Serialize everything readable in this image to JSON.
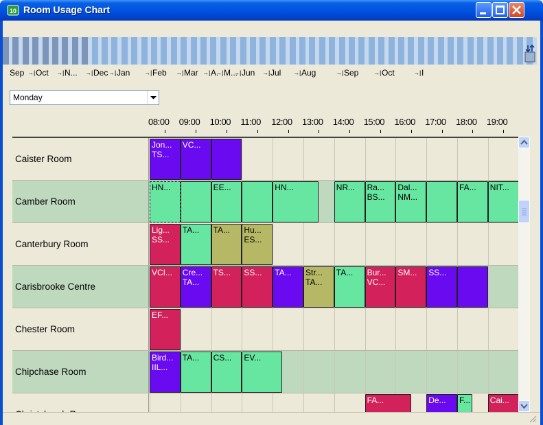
{
  "window": {
    "title": "Room Usage Chart"
  },
  "colors": {
    "green": "#66e6a0",
    "purple": "#6a0af0",
    "crimson": "#d3215c",
    "olive": "#b6b865",
    "rowGreen": "#bfd9bf",
    "rowBeige": "#ece9d8"
  },
  "months": [
    "Sep",
    "Oct",
    "N...",
    "Dec",
    "Jan",
    "Feb",
    "Mar",
    "A.",
    "M...",
    "Jun",
    "Jul",
    "Aug",
    "Sep",
    "Oct",
    "I"
  ],
  "day_select": {
    "value": "Monday"
  },
  "times": [
    "08:00",
    "09:00",
    "10:00",
    "11:00",
    "12:00",
    "13:00",
    "14:00",
    "15:00",
    "16:00",
    "17:00",
    "18:00",
    "19:00"
  ],
  "rooms": [
    {
      "name": "Caister Room",
      "bg": "#ece9d8",
      "bookings": [
        {
          "l1": "Jon...",
          "l2": "TS...",
          "color": "#6a0af0",
          "start": 0,
          "span": 1
        },
        {
          "l1": "VC...",
          "l2": "",
          "color": "#6a0af0",
          "start": 1,
          "span": 1
        },
        {
          "l1": "",
          "l2": "",
          "color": "#6a0af0",
          "start": 2,
          "span": 1
        }
      ]
    },
    {
      "name": "Camber Room",
      "bg": "#bfd9bf",
      "bookings": [
        {
          "l1": "HN...",
          "l2": "",
          "color": "#66e6a0",
          "start": 0,
          "span": 1,
          "dashed": true
        },
        {
          "l1": "",
          "l2": "",
          "color": "#66e6a0",
          "start": 1,
          "span": 1
        },
        {
          "l1": "EE...",
          "l2": "",
          "color": "#66e6a0",
          "start": 2,
          "span": 1
        },
        {
          "l1": "",
          "l2": "",
          "color": "#66e6a0",
          "start": 3,
          "span": 1
        },
        {
          "l1": "HN...",
          "l2": "",
          "color": "#66e6a0",
          "start": 4,
          "span": 1.5
        },
        {
          "l1": "NR...",
          "l2": "",
          "color": "#66e6a0",
          "start": 6,
          "span": 1
        },
        {
          "l1": "Ra...",
          "l2": "BS...",
          "color": "#66e6a0",
          "start": 7,
          "span": 1
        },
        {
          "l1": "Dal...",
          "l2": "NM...",
          "color": "#66e6a0",
          "start": 8,
          "span": 1
        },
        {
          "l1": "",
          "l2": "",
          "color": "#66e6a0",
          "start": 9,
          "span": 1
        },
        {
          "l1": "FA...",
          "l2": "",
          "color": "#66e6a0",
          "start": 10,
          "span": 1
        },
        {
          "l1": "NIT...",
          "l2": "",
          "color": "#66e6a0",
          "start": 11,
          "span": 1
        }
      ]
    },
    {
      "name": "Canterbury Room",
      "bg": "#ece9d8",
      "bookings": [
        {
          "l1": "Lig...",
          "l2": "SS...",
          "color": "#d3215c",
          "start": 0,
          "span": 1
        },
        {
          "l1": "TA...",
          "l2": "",
          "color": "#66e6a0",
          "start": 1,
          "span": 1
        },
        {
          "l1": "TA...",
          "l2": "",
          "color": "#b6b865",
          "start": 2,
          "span": 1
        },
        {
          "l1": "Hu...",
          "l2": "ES...",
          "color": "#b6b865",
          "start": 3,
          "span": 1
        }
      ]
    },
    {
      "name": "Carisbrooke Centre",
      "bg": "#bfd9bf",
      "bookings": [
        {
          "l1": "VCI...",
          "l2": "",
          "color": "#d3215c",
          "start": 0,
          "span": 1
        },
        {
          "l1": "Cre...",
          "l2": "TA...",
          "color": "#6a0af0",
          "start": 1,
          "span": 1
        },
        {
          "l1": "TS...",
          "l2": "",
          "color": "#d3215c",
          "start": 2,
          "span": 1
        },
        {
          "l1": "SS...",
          "l2": "",
          "color": "#d3215c",
          "start": 3,
          "span": 1
        },
        {
          "l1": "TA...",
          "l2": "",
          "color": "#6a0af0",
          "start": 4,
          "span": 1
        },
        {
          "l1": "Str...",
          "l2": "TA...",
          "color": "#b6b865",
          "start": 5,
          "span": 1
        },
        {
          "l1": "TA...",
          "l2": "",
          "color": "#66e6a0",
          "start": 6,
          "span": 1
        },
        {
          "l1": "Bur...",
          "l2": "VC...",
          "color": "#d3215c",
          "start": 7,
          "span": 1
        },
        {
          "l1": "SM...",
          "l2": "",
          "color": "#d3215c",
          "start": 8,
          "span": 1
        },
        {
          "l1": "SS...",
          "l2": "",
          "color": "#6a0af0",
          "start": 9,
          "span": 1
        },
        {
          "l1": "",
          "l2": "",
          "color": "#6a0af0",
          "start": 10,
          "span": 1
        }
      ]
    },
    {
      "name": "Chester Room",
      "bg": "#ece9d8",
      "bookings": [
        {
          "l1": "EF...",
          "l2": "",
          "color": "#d3215c",
          "start": 0,
          "span": 1
        }
      ]
    },
    {
      "name": "Chipchase Room",
      "bg": "#bfd9bf",
      "bookings": [
        {
          "l1": "Bird...",
          "l2": "IIL...",
          "color": "#6a0af0",
          "start": 0,
          "span": 1
        },
        {
          "l1": "TA...",
          "l2": "",
          "color": "#66e6a0",
          "start": 1,
          "span": 1
        },
        {
          "l1": "CS...",
          "l2": "",
          "color": "#66e6a0",
          "start": 2,
          "span": 1
        },
        {
          "l1": "EV...",
          "l2": "",
          "color": "#66e6a0",
          "start": 3,
          "span": 1.3
        }
      ]
    },
    {
      "name": "Christchurch Room",
      "bg": "#ece9d8",
      "bookings": [
        {
          "l1": "FA...",
          "l2": "",
          "color": "#d3215c",
          "start": 7,
          "span": 1.5
        },
        {
          "l1": "De...",
          "l2": "",
          "color": "#6a0af0",
          "start": 9,
          "span": 1
        },
        {
          "l1": "F...",
          "l2": "",
          "color": "#66e6a0",
          "start": 10,
          "span": 0.5
        },
        {
          "l1": "Cai...",
          "l2": "",
          "color": "#d3215c",
          "start": 11,
          "span": 1
        }
      ]
    }
  ]
}
